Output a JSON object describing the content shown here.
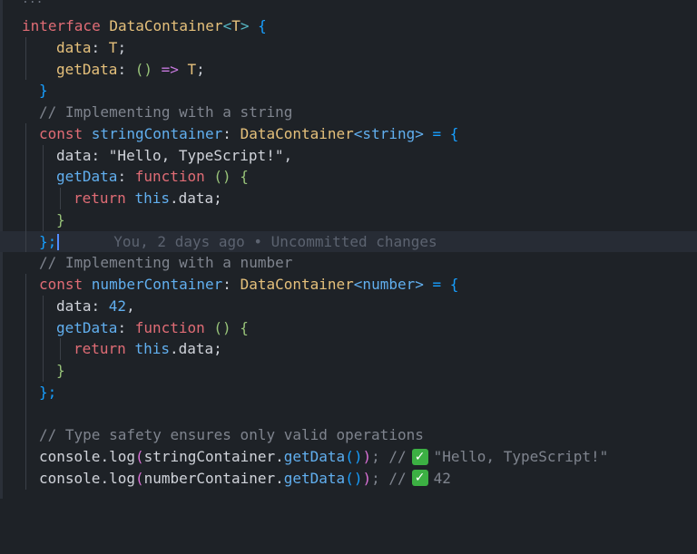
{
  "editor": {
    "folded_marker": "...",
    "blame_text": "You, 2 days ago • Uncommitted changes",
    "lines": {
      "l1": {
        "a": "interface ",
        "b": "DataContainer",
        "c": "<",
        "d": "T",
        "e": ">",
        "f": " {"
      },
      "l2": {
        "a": "data",
        "b": ": ",
        "c": "T",
        "d": ";"
      },
      "l3": {
        "a": "getData",
        "b": ": ",
        "c": "()",
        "d": " => ",
        "e": "T",
        "f": ";"
      },
      "l4": {
        "a": "}"
      },
      "l5": {
        "a": "// Implementing with a string"
      },
      "l6": {
        "a": "const ",
        "b": "stringContainer",
        "c": ": ",
        "d": "DataContainer",
        "e": "<string>",
        "f": " = {"
      },
      "l7": {
        "a": "data",
        "b": ": ",
        "c": "\"Hello, TypeScript!\"",
        "d": ","
      },
      "l8": {
        "a": "getData",
        "b": ": ",
        "c": "function",
        "d": " ()",
        "e": " {"
      },
      "l9": {
        "a": "return ",
        "b": "this",
        "c": ".data;"
      },
      "l10": {
        "a": "}"
      },
      "l11": {
        "a": "};"
      },
      "l12": {
        "a": "// Implementing with a number"
      },
      "l13": {
        "a": "const ",
        "b": "numberContainer",
        "c": ": ",
        "d": "DataContainer",
        "e": "<number>",
        "f": " = {"
      },
      "l14": {
        "a": "data",
        "b": ": ",
        "c": "42",
        "d": ","
      },
      "l15": {
        "a": "getData",
        "b": ": ",
        "c": "function",
        "d": " ()",
        "e": " {"
      },
      "l16": {
        "a": "return ",
        "b": "this",
        "c": ".data;"
      },
      "l17": {
        "a": "}"
      },
      "l18": {
        "a": "};"
      },
      "l19": {},
      "l20": {
        "a": "// Type safety ensures only valid operations"
      },
      "l21": {
        "a": "console",
        "b": ".log",
        "c": "(",
        "d": "stringContainer",
        "e": ".",
        "f": "getData",
        "g": "()",
        "h": ")",
        "i": "; //",
        "j": "✓",
        "k": "\"Hello, TypeScript!\""
      },
      "l22": {
        "a": "console",
        "b": ".log",
        "c": "(",
        "d": "numberContainer",
        "e": ".",
        "f": "getData",
        "g": "()",
        "h": ")",
        "i": "; //",
        "j": "✓",
        "k": "42"
      }
    }
  }
}
